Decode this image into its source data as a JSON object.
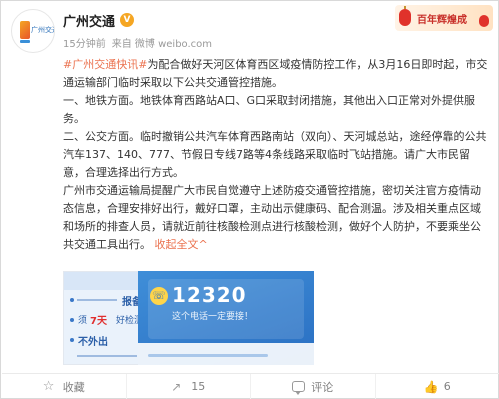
{
  "account": {
    "name": "广州交通",
    "verified_badge": "V",
    "logo_text": "广州交通"
  },
  "meta": {
    "time": "15分钟前",
    "source": "来自 微博 weibo.com"
  },
  "banner": {
    "text": "百年辉煌成"
  },
  "post": {
    "hashtag": "#广州交通快讯#",
    "p1_rest": "为配合做好天河区体育西区域疫情防控工作，从3月16日即时起，市交通运输部门临时采取以下公共交通管控措施。",
    "p2": "一、地铁方面。地铁体育西路站A口、G口采取封闭措施，其他出入口正常对外提供服务。",
    "p3": "二、公交方面。临时撤销公共汽车体育西路南站（双向）、天河城总站，途经停靠的公共汽车137、140、777、节假日专线7路等4条线路采取临时飞站措施。请广大市民留意，合理选择出行方式。",
    "p4": "广州市交通运输局提醒广大市民自觉遵守上述防疫交通管控措施，密切关注官方疫情动态信息，合理安排好出行，戴好口罩，主动出示健康码、配合测温。涉及相关重点区域和场所的排查人员，请就近前往核酸检测点进行核酸检测，做好个人防护，不要乘坐公共交通工具出行。",
    "more_label": "收起全文",
    "more_arrow": "^"
  },
  "images": {
    "img1": {
      "report": "报备",
      "days_prefix": "须",
      "days": "7天",
      "days_suffix": "好检测",
      "no_out": "不外出",
      "check": "✓"
    },
    "img2": {
      "hotline": "12320",
      "hotline_sub": "这个电话一定要接！",
      "phone_symbol": "☏"
    }
  },
  "actions": {
    "favorite": {
      "label": "收藏",
      "icon": "star-icon",
      "glyph": "☆"
    },
    "share": {
      "label": "15",
      "icon": "share-icon",
      "glyph": "↗"
    },
    "comment": {
      "label": "评论",
      "icon": "comment-icon"
    },
    "like": {
      "label": "6",
      "icon": "like-icon",
      "glyph": "👍"
    }
  },
  "colors": {
    "link": "#eb7350",
    "verified": "#f5a623",
    "hotline_bg": "#2a6fc2"
  }
}
